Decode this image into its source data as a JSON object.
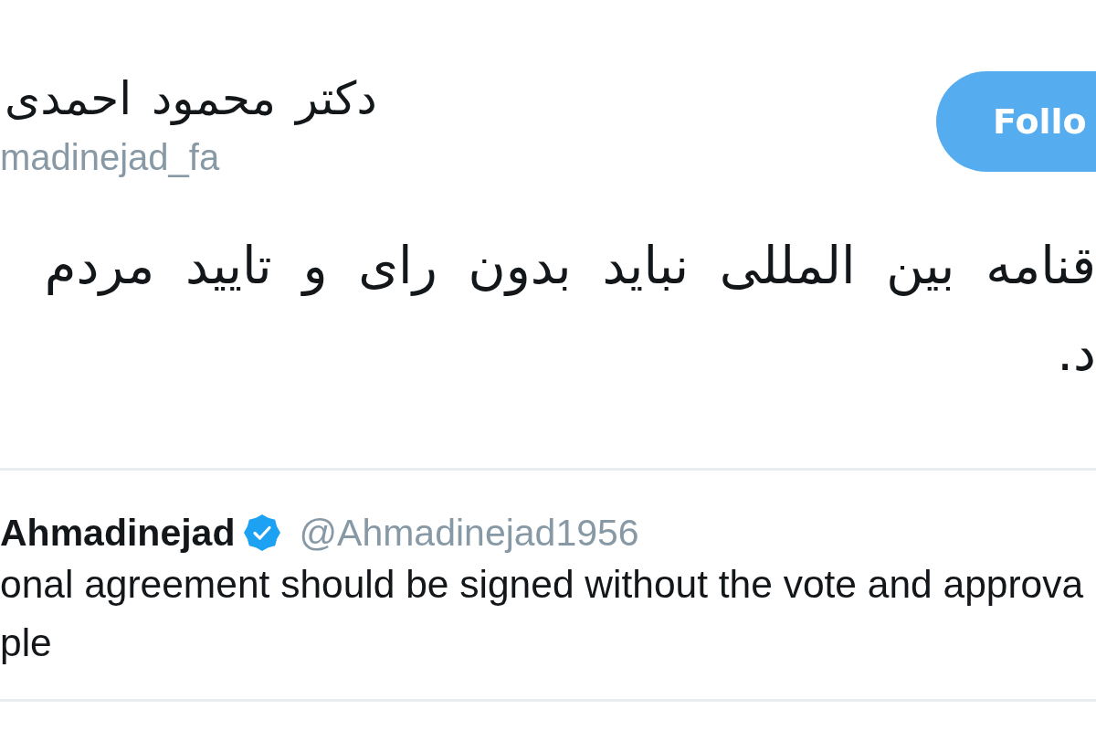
{
  "profile": {
    "display_name": "دکتر محمود احمدی",
    "handle": "madinejad_fa"
  },
  "follow_button": {
    "label": "Follo"
  },
  "tweet_text_lines": [
    "قنامه بین المللی نباید بدون رای و تایید مردم",
    "د."
  ],
  "quoted_tweet": {
    "display_name": "Ahmadinejad",
    "verified": true,
    "handle": "@Ahmadinejad1956",
    "text_lines": [
      "onal agreement should be signed without the vote and approva",
      "ple"
    ]
  }
}
